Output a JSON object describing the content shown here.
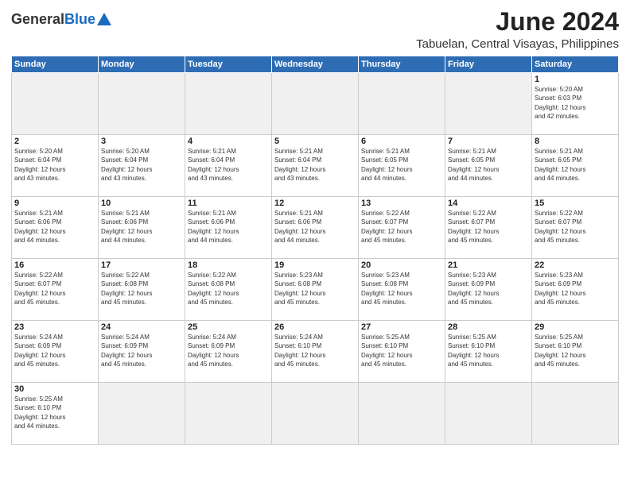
{
  "header": {
    "logo_general": "General",
    "logo_blue": "Blue",
    "month_year": "June 2024",
    "location": "Tabuelan, Central Visayas, Philippines"
  },
  "weekdays": [
    "Sunday",
    "Monday",
    "Tuesday",
    "Wednesday",
    "Thursday",
    "Friday",
    "Saturday"
  ],
  "days": [
    {
      "num": "",
      "info": ""
    },
    {
      "num": "",
      "info": ""
    },
    {
      "num": "",
      "info": ""
    },
    {
      "num": "",
      "info": ""
    },
    {
      "num": "",
      "info": ""
    },
    {
      "num": "",
      "info": ""
    },
    {
      "num": "1",
      "info": "Sunrise: 5:20 AM\nSunset: 6:03 PM\nDaylight: 12 hours\nand 42 minutes."
    },
    {
      "num": "2",
      "info": "Sunrise: 5:20 AM\nSunset: 6:04 PM\nDaylight: 12 hours\nand 43 minutes."
    },
    {
      "num": "3",
      "info": "Sunrise: 5:20 AM\nSunset: 6:04 PM\nDaylight: 12 hours\nand 43 minutes."
    },
    {
      "num": "4",
      "info": "Sunrise: 5:21 AM\nSunset: 6:04 PM\nDaylight: 12 hours\nand 43 minutes."
    },
    {
      "num": "5",
      "info": "Sunrise: 5:21 AM\nSunset: 6:04 PM\nDaylight: 12 hours\nand 43 minutes."
    },
    {
      "num": "6",
      "info": "Sunrise: 5:21 AM\nSunset: 6:05 PM\nDaylight: 12 hours\nand 44 minutes."
    },
    {
      "num": "7",
      "info": "Sunrise: 5:21 AM\nSunset: 6:05 PM\nDaylight: 12 hours\nand 44 minutes."
    },
    {
      "num": "8",
      "info": "Sunrise: 5:21 AM\nSunset: 6:05 PM\nDaylight: 12 hours\nand 44 minutes."
    },
    {
      "num": "9",
      "info": "Sunrise: 5:21 AM\nSunset: 6:06 PM\nDaylight: 12 hours\nand 44 minutes."
    },
    {
      "num": "10",
      "info": "Sunrise: 5:21 AM\nSunset: 6:06 PM\nDaylight: 12 hours\nand 44 minutes."
    },
    {
      "num": "11",
      "info": "Sunrise: 5:21 AM\nSunset: 6:06 PM\nDaylight: 12 hours\nand 44 minutes."
    },
    {
      "num": "12",
      "info": "Sunrise: 5:21 AM\nSunset: 6:06 PM\nDaylight: 12 hours\nand 44 minutes."
    },
    {
      "num": "13",
      "info": "Sunrise: 5:22 AM\nSunset: 6:07 PM\nDaylight: 12 hours\nand 45 minutes."
    },
    {
      "num": "14",
      "info": "Sunrise: 5:22 AM\nSunset: 6:07 PM\nDaylight: 12 hours\nand 45 minutes."
    },
    {
      "num": "15",
      "info": "Sunrise: 5:22 AM\nSunset: 6:07 PM\nDaylight: 12 hours\nand 45 minutes."
    },
    {
      "num": "16",
      "info": "Sunrise: 5:22 AM\nSunset: 6:07 PM\nDaylight: 12 hours\nand 45 minutes."
    },
    {
      "num": "17",
      "info": "Sunrise: 5:22 AM\nSunset: 6:08 PM\nDaylight: 12 hours\nand 45 minutes."
    },
    {
      "num": "18",
      "info": "Sunrise: 5:22 AM\nSunset: 6:08 PM\nDaylight: 12 hours\nand 45 minutes."
    },
    {
      "num": "19",
      "info": "Sunrise: 5:23 AM\nSunset: 6:08 PM\nDaylight: 12 hours\nand 45 minutes."
    },
    {
      "num": "20",
      "info": "Sunrise: 5:23 AM\nSunset: 6:08 PM\nDaylight: 12 hours\nand 45 minutes."
    },
    {
      "num": "21",
      "info": "Sunrise: 5:23 AM\nSunset: 6:09 PM\nDaylight: 12 hours\nand 45 minutes."
    },
    {
      "num": "22",
      "info": "Sunrise: 5:23 AM\nSunset: 6:09 PM\nDaylight: 12 hours\nand 45 minutes."
    },
    {
      "num": "23",
      "info": "Sunrise: 5:24 AM\nSunset: 6:09 PM\nDaylight: 12 hours\nand 45 minutes."
    },
    {
      "num": "24",
      "info": "Sunrise: 5:24 AM\nSunset: 6:09 PM\nDaylight: 12 hours\nand 45 minutes."
    },
    {
      "num": "25",
      "info": "Sunrise: 5:24 AM\nSunset: 6:09 PM\nDaylight: 12 hours\nand 45 minutes."
    },
    {
      "num": "26",
      "info": "Sunrise: 5:24 AM\nSunset: 6:10 PM\nDaylight: 12 hours\nand 45 minutes."
    },
    {
      "num": "27",
      "info": "Sunrise: 5:25 AM\nSunset: 6:10 PM\nDaylight: 12 hours\nand 45 minutes."
    },
    {
      "num": "28",
      "info": "Sunrise: 5:25 AM\nSunset: 6:10 PM\nDaylight: 12 hours\nand 45 minutes."
    },
    {
      "num": "29",
      "info": "Sunrise: 5:25 AM\nSunset: 6:10 PM\nDaylight: 12 hours\nand 45 minutes."
    },
    {
      "num": "30",
      "info": "Sunrise: 5:25 AM\nSunset: 6:10 PM\nDaylight: 12 hours\nand 44 minutes."
    },
    {
      "num": "",
      "info": ""
    },
    {
      "num": "",
      "info": ""
    },
    {
      "num": "",
      "info": ""
    },
    {
      "num": "",
      "info": ""
    },
    {
      "num": "",
      "info": ""
    },
    {
      "num": "",
      "info": ""
    }
  ]
}
